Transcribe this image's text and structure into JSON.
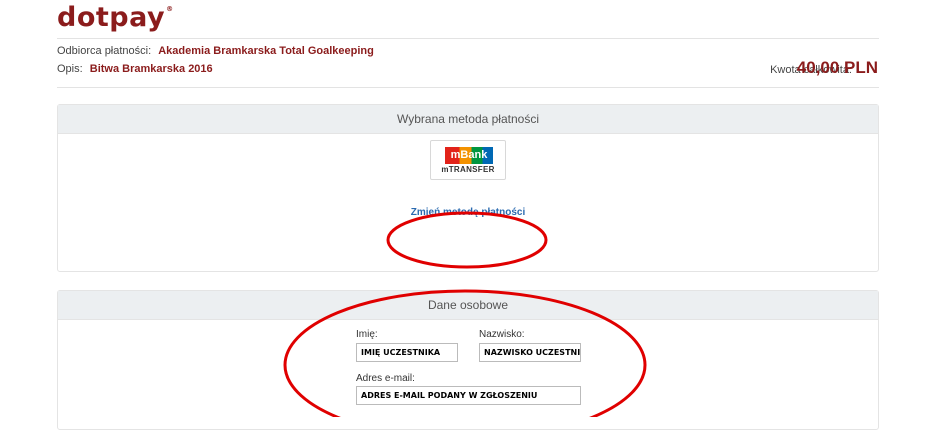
{
  "header": {
    "logo_text": "dotpay",
    "logo_mark": "®"
  },
  "order": {
    "recipient_label": "Odbiorca płatności:",
    "recipient_value": "Akademia Bramkarska Total Goalkeeping",
    "description_label": "Opis:",
    "description_value": "Bitwa Bramkarska 2016",
    "total_label": "Kwota całkowita:",
    "total_amount": "40,00 PLN"
  },
  "payment_method": {
    "title": "Wybrana metoda płatności",
    "bank_brand": "mBank",
    "bank_product": "mTRANSFER",
    "change_link": "Zmień metodę płatności"
  },
  "personal": {
    "title": "Dane osobowe",
    "first_name_label": "Imię:",
    "first_name_value": "IMIĘ UCZESTNIKA",
    "last_name_label": "Nazwisko:",
    "last_name_value": "NAZWISKO UCZESTNIKA",
    "email_label": "Adres e-mail:",
    "email_value": "ADRES E-MAIL PODANY W ZGŁOSZENIU"
  },
  "colors": {
    "brand": "#8b1c1c",
    "link": "#2a6ab0",
    "annotation": "#e00000"
  }
}
